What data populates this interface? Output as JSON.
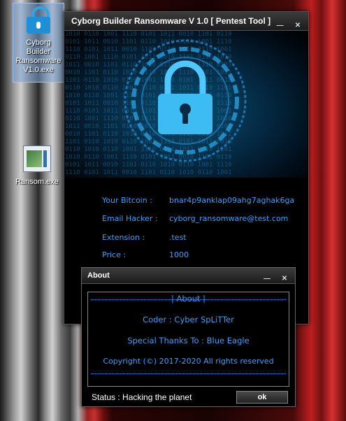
{
  "desktop": {
    "icons": [
      {
        "label": "Cyborg Builder Ransomware V1.0.exe",
        "icon": "padlock-icon"
      },
      {
        "label": "Ransom.exe",
        "icon": "executable-icon"
      }
    ]
  },
  "main_window": {
    "title": "Cyborg Builder Ransomware V 1.0  [ Pentest Tool ]",
    "banner_icon": "padlock-icon",
    "fields": [
      {
        "label": "Your Bitcoin :",
        "value": "bnar4p9anklap09ahg7aghak6ga"
      },
      {
        "label": "Email Hacker :",
        "value": "cyborg_ransomware@test.com"
      },
      {
        "label": "Extension :",
        "value": ".test"
      },
      {
        "label": "Price :",
        "value": "1000"
      }
    ]
  },
  "about_window": {
    "title": "About",
    "header": "|  About  |",
    "coder": "Coder : Cyber SpLiTTer",
    "thanks": "Special Thanks To : Blue Eagle",
    "copyright": "Copyright (©) 2017-2020 All rights reserved",
    "status": "Status : Hacking the planet",
    "ok_label": "ok"
  },
  "colors": {
    "accent": "#3aa0ff",
    "background": "#000000"
  }
}
